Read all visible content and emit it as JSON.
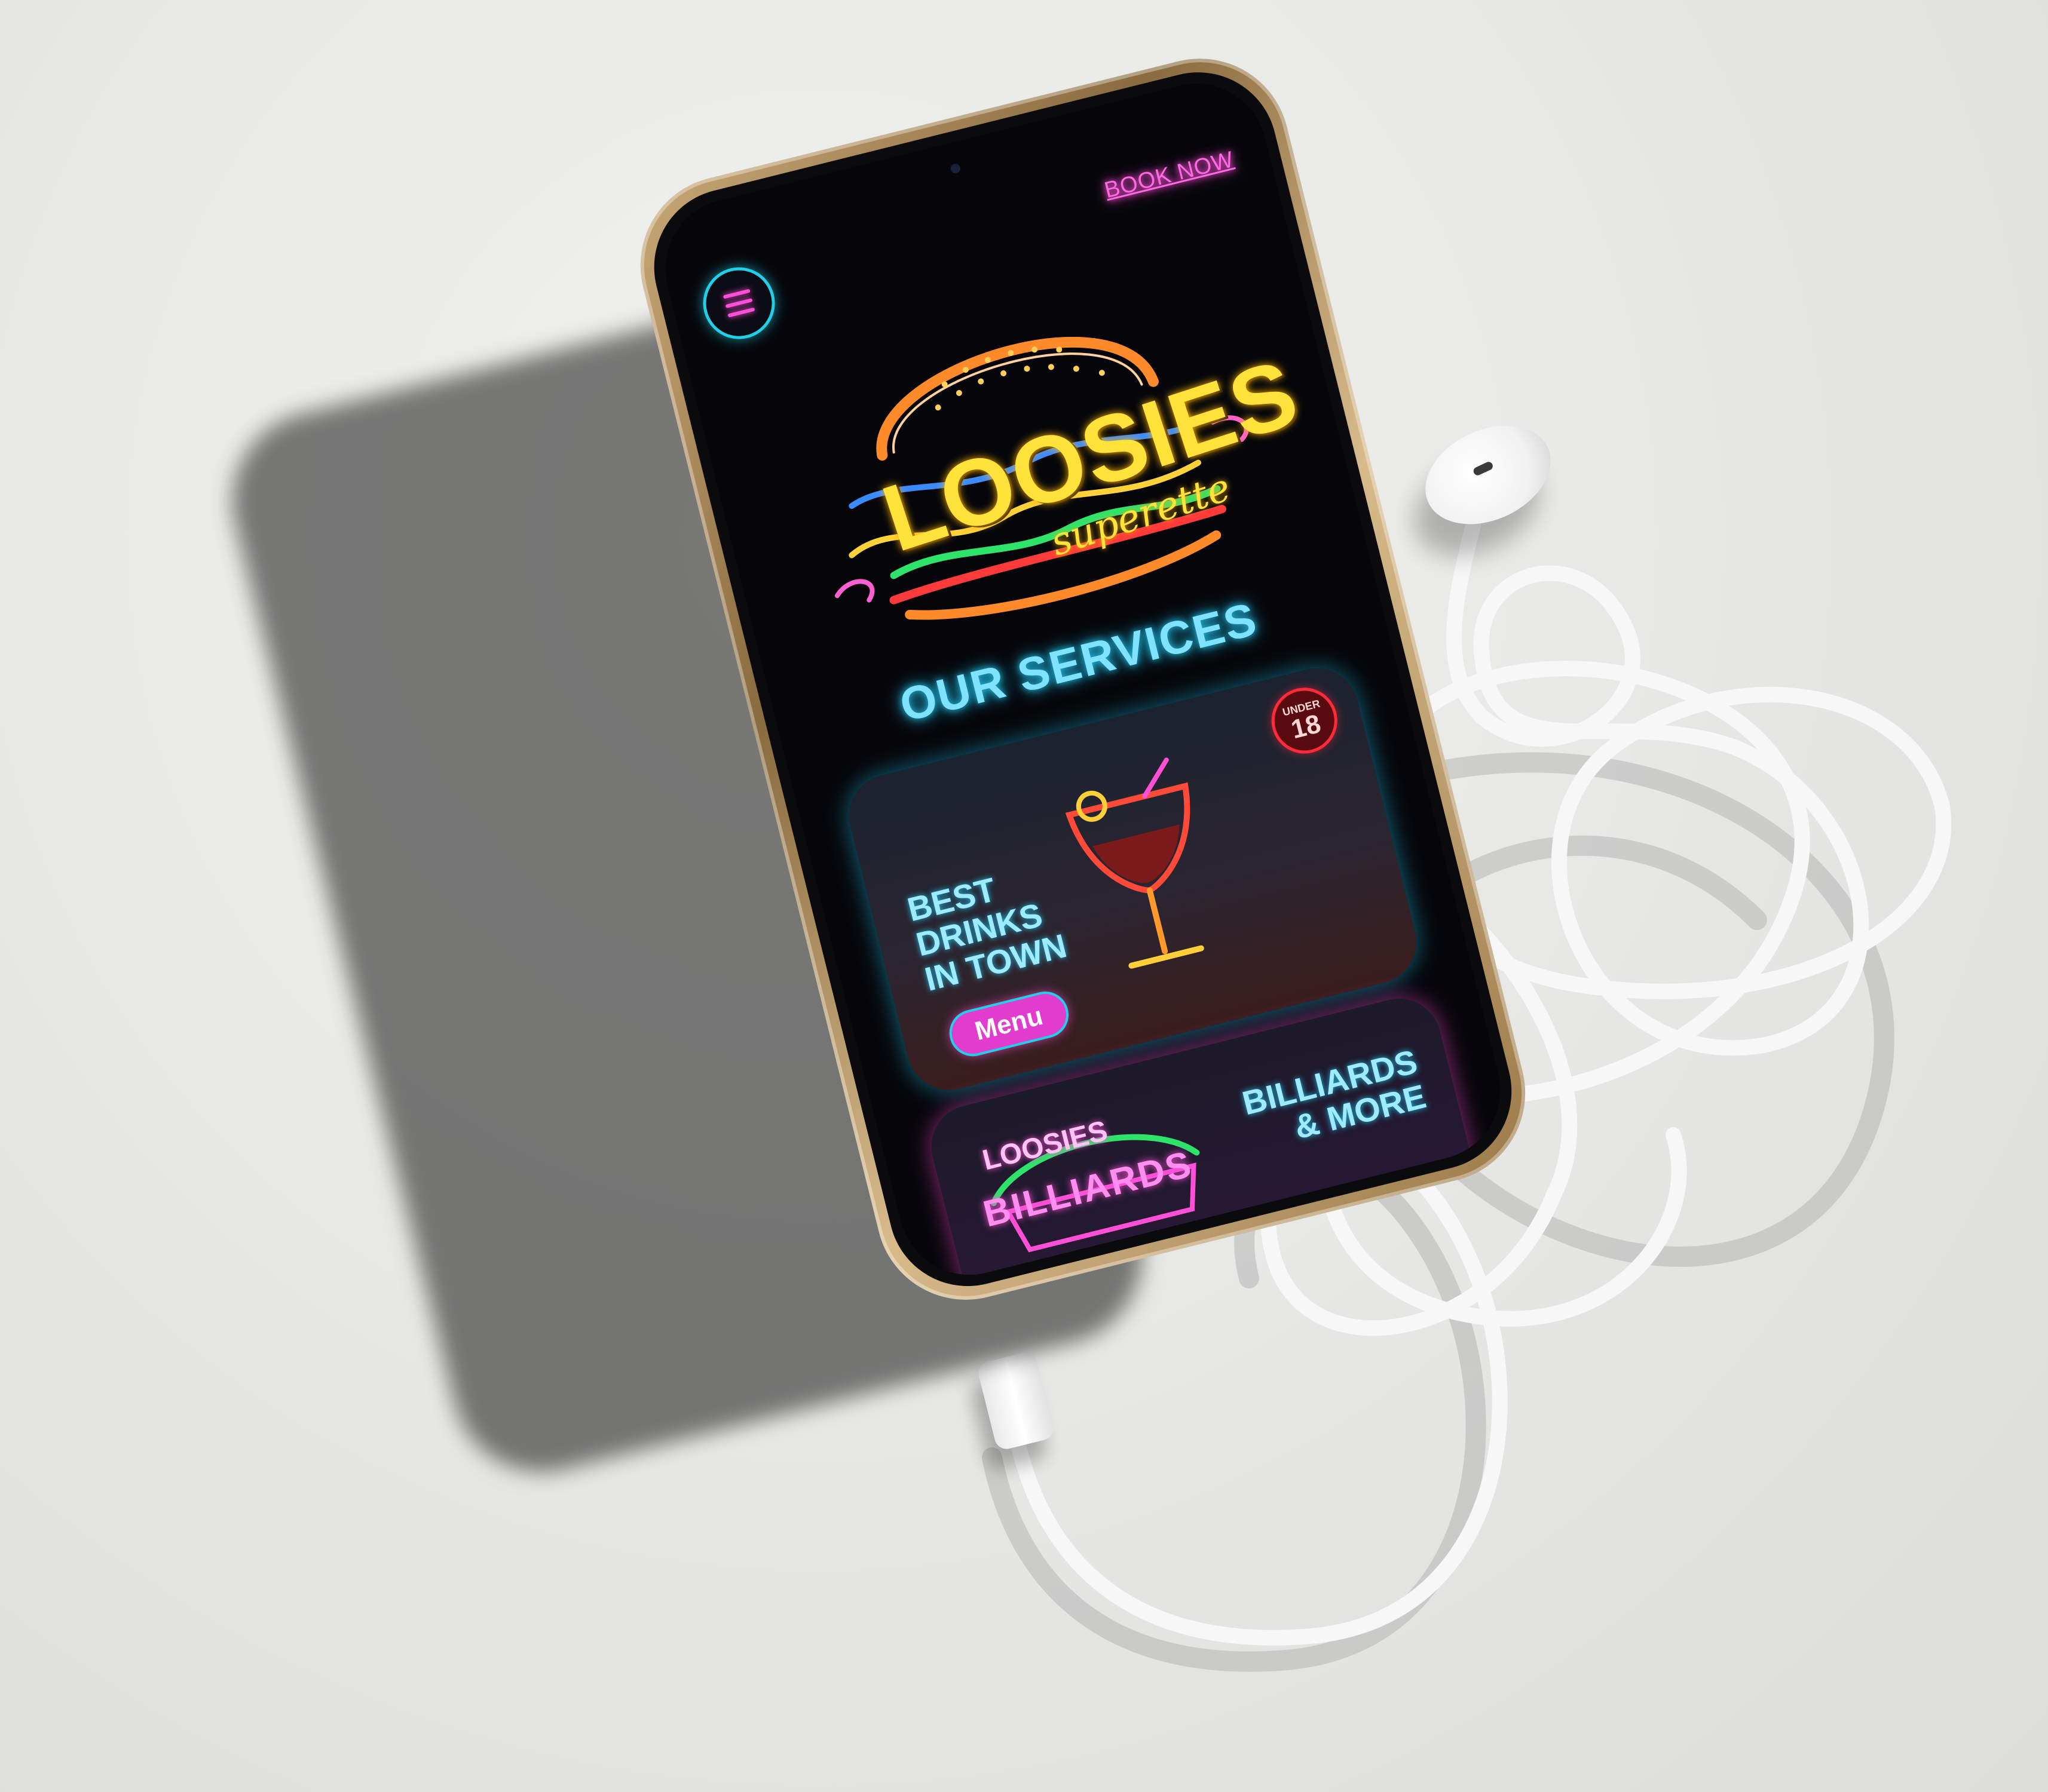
{
  "header": {
    "book_now": "BOOK NOW"
  },
  "logo": {
    "title": "LOOSIES",
    "subtitle": "superette"
  },
  "services": {
    "title": "OUR SERVICES",
    "cards": [
      {
        "text": "BEST\nDRINKS\nIN TOWN",
        "button": "Menu",
        "badge_top": "UNDER",
        "badge_num": "18"
      },
      {
        "text": "BILLIARDS\n& MORE",
        "sign_top": "LOOSIES",
        "sign_main": "BILLIARDS"
      }
    ]
  },
  "colors": {
    "neon_pink": "#ff4fd8",
    "neon_cyan": "#21d0e8",
    "neon_yellow": "#ffe23a",
    "screen_bg": "#06060a"
  },
  "icons": [
    "hamburger-menu-icon",
    "burger-logo-icon",
    "cocktail-glass-icon",
    "billiard-cues-icon"
  ]
}
